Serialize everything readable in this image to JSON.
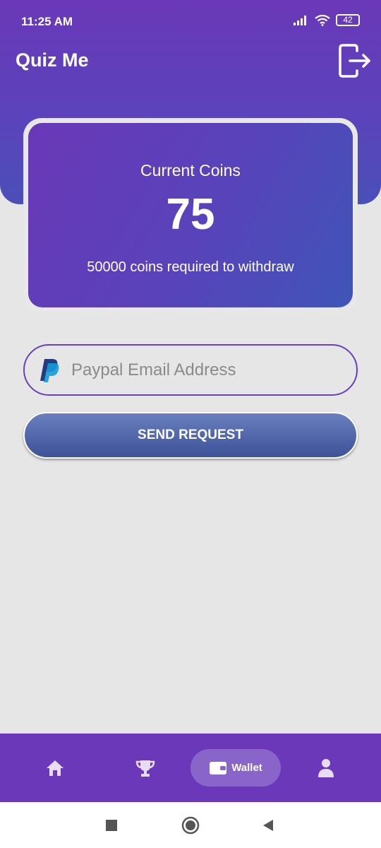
{
  "status_bar": {
    "time": "11:25 AM",
    "battery": "42",
    "icons": [
      "signal-icon",
      "wifi-icon",
      "battery-icon"
    ]
  },
  "app": {
    "title": "Quiz Me",
    "logout_icon": "logout-icon"
  },
  "coins": {
    "label": "Current Coins",
    "value": "75",
    "note": "50000 coins required to withdraw"
  },
  "withdraw": {
    "email_placeholder": "Paypal Email Address",
    "email_value": "",
    "field_icon": "paypal-icon",
    "send_label": "SEND REQUEST"
  },
  "bottom_nav": {
    "items": [
      {
        "icon": "home-icon",
        "label": ""
      },
      {
        "icon": "trophy-icon",
        "label": ""
      },
      {
        "icon": "wallet-icon",
        "label": "Wallet",
        "active": true
      },
      {
        "icon": "profile-icon",
        "label": ""
      }
    ]
  },
  "system_nav": [
    "recent-apps-icon",
    "home-circle-icon",
    "back-icon"
  ],
  "colors": {
    "primary": "#6a38b8",
    "accent_blue": "#3f55b8",
    "background": "#e6e6e6",
    "button": "#4a5fa8"
  }
}
